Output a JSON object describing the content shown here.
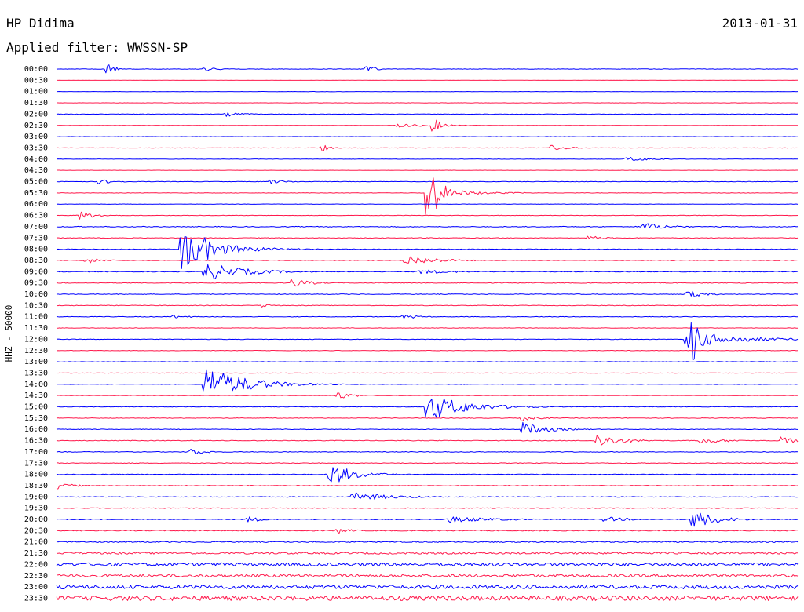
{
  "header": {
    "station": "HP Didima",
    "date": "2013-01-31",
    "filter_label": "Applied filter: WWSSN-SP"
  },
  "chart_data": {
    "type": "line",
    "chart_kind": "helicorder",
    "title": "HP Didima",
    "subtitle": "Applied filter: WWSSN-SP",
    "date": "2013-01-31",
    "ylabel": "HHZ - 50000",
    "xlabel": "",
    "grid": false,
    "legend": "none",
    "colors": [
      "#0000ff",
      "#ff1a4d"
    ],
    "row_ticks": [
      "00:00",
      "00:30",
      "01:00",
      "01:30",
      "02:00",
      "02:30",
      "03:00",
      "03:30",
      "04:00",
      "04:30",
      "05:00",
      "05:30",
      "06:00",
      "06:30",
      "07:00",
      "07:30",
      "08:00",
      "08:30",
      "09:00",
      "09:30",
      "10:00",
      "10:30",
      "11:00",
      "11:30",
      "12:00",
      "12:30",
      "13:00",
      "13:30",
      "14:00",
      "14:30",
      "15:00",
      "15:30",
      "16:00",
      "16:30",
      "17:00",
      "17:30",
      "18:00",
      "18:30",
      "19:00",
      "19:30",
      "20:00",
      "20:30",
      "21:00",
      "21:30",
      "22:00",
      "22:30",
      "23:00",
      "23:30"
    ],
    "row_noise": [
      0.05,
      0.01,
      0.03,
      0.03,
      0.05,
      0.03,
      0.04,
      0.04,
      0.04,
      0.03,
      0.05,
      0.05,
      0.04,
      0.04,
      0.08,
      0.06,
      0.07,
      0.07,
      0.08,
      0.07,
      0.07,
      0.06,
      0.06,
      0.05,
      0.05,
      0.05,
      0.05,
      0.05,
      0.05,
      0.05,
      0.06,
      0.06,
      0.06,
      0.07,
      0.07,
      0.07,
      0.07,
      0.07,
      0.07,
      0.08,
      0.08,
      0.1,
      0.12,
      0.2,
      0.35,
      0.3,
      0.4,
      0.5
    ],
    "events": [
      {
        "row": 0,
        "x": 0.07,
        "amp": 1.2,
        "dur": 0.01
      },
      {
        "row": 0,
        "x": 0.2,
        "amp": 0.5,
        "dur": 0.02
      },
      {
        "row": 0,
        "x": 0.42,
        "amp": 0.8,
        "dur": 0.01
      },
      {
        "row": 4,
        "x": 0.23,
        "amp": 0.5,
        "dur": 0.02
      },
      {
        "row": 5,
        "x": 0.46,
        "amp": 0.4,
        "dur": 0.05
      },
      {
        "row": 5,
        "x": 0.51,
        "amp": 1.5,
        "dur": 0.01
      },
      {
        "row": 7,
        "x": 0.36,
        "amp": 0.7,
        "dur": 0.01
      },
      {
        "row": 7,
        "x": 0.67,
        "amp": 0.6,
        "dur": 0.02
      },
      {
        "row": 8,
        "x": 0.77,
        "amp": 0.5,
        "dur": 0.03
      },
      {
        "row": 10,
        "x": 0.06,
        "amp": 0.5,
        "dur": 0.02
      },
      {
        "row": 10,
        "x": 0.29,
        "amp": 0.5,
        "dur": 0.02
      },
      {
        "row": 11,
        "x": 0.5,
        "amp": 8.0,
        "dur": 0.015
      },
      {
        "row": 11,
        "x": 0.51,
        "amp": 1.0,
        "dur": 0.05
      },
      {
        "row": 13,
        "x": 0.03,
        "amp": 1.0,
        "dur": 0.02
      },
      {
        "row": 14,
        "x": 0.79,
        "amp": 1.0,
        "dur": 0.03
      },
      {
        "row": 15,
        "x": 0.72,
        "amp": 0.5,
        "dur": 0.02
      },
      {
        "row": 16,
        "x": 0.17,
        "amp": 4.5,
        "dur": 0.04
      },
      {
        "row": 16,
        "x": 0.2,
        "amp": 2.5,
        "dur": 0.03
      },
      {
        "row": 16,
        "x": 0.23,
        "amp": 1.0,
        "dur": 0.05
      },
      {
        "row": 17,
        "x": 0.04,
        "amp": 0.7,
        "dur": 0.02
      },
      {
        "row": 17,
        "x": 0.47,
        "amp": 1.2,
        "dur": 0.04
      },
      {
        "row": 18,
        "x": 0.2,
        "amp": 2.0,
        "dur": 0.05
      },
      {
        "row": 18,
        "x": 0.49,
        "amp": 0.5,
        "dur": 0.05
      },
      {
        "row": 19,
        "x": 0.32,
        "amp": 1.0,
        "dur": 0.02
      },
      {
        "row": 20,
        "x": 0.85,
        "amp": 1.0,
        "dur": 0.02
      },
      {
        "row": 21,
        "x": 0.28,
        "amp": 0.5,
        "dur": 0.01
      },
      {
        "row": 22,
        "x": 0.16,
        "amp": 0.4,
        "dur": 0.02
      },
      {
        "row": 22,
        "x": 0.47,
        "amp": 0.5,
        "dur": 0.02
      },
      {
        "row": 24,
        "x": 0.85,
        "amp": 2.0,
        "dur": 0.06
      },
      {
        "row": 24,
        "x": 0.86,
        "amp": 5.0,
        "dur": 0.01
      },
      {
        "row": 28,
        "x": 0.2,
        "amp": 4.0,
        "dur": 0.05
      },
      {
        "row": 29,
        "x": 0.38,
        "amp": 0.8,
        "dur": 0.02
      },
      {
        "row": 30,
        "x": 0.5,
        "amp": 3.0,
        "dur": 0.05
      },
      {
        "row": 31,
        "x": 0.63,
        "amp": 0.6,
        "dur": 0.02
      },
      {
        "row": 32,
        "x": 0.63,
        "amp": 1.5,
        "dur": 0.03
      },
      {
        "row": 33,
        "x": 0.73,
        "amp": 1.5,
        "dur": 0.03
      },
      {
        "row": 33,
        "x": 0.87,
        "amp": 0.8,
        "dur": 0.03
      },
      {
        "row": 33,
        "x": 0.98,
        "amp": 0.8,
        "dur": 0.02
      },
      {
        "row": 34,
        "x": 0.18,
        "amp": 0.8,
        "dur": 0.02
      },
      {
        "row": 36,
        "x": 0.37,
        "amp": 2.5,
        "dur": 0.03
      },
      {
        "row": 37,
        "x": 0.0,
        "amp": 0.8,
        "dur": 0.02
      },
      {
        "row": 38,
        "x": 0.4,
        "amp": 1.0,
        "dur": 0.05
      },
      {
        "row": 40,
        "x": 0.26,
        "amp": 0.6,
        "dur": 0.02
      },
      {
        "row": 40,
        "x": 0.53,
        "amp": 0.7,
        "dur": 0.06
      },
      {
        "row": 40,
        "x": 0.74,
        "amp": 0.6,
        "dur": 0.03
      },
      {
        "row": 40,
        "x": 0.86,
        "amp": 2.0,
        "dur": 0.03
      },
      {
        "row": 41,
        "x": 0.38,
        "amp": 0.6,
        "dur": 0.02
      }
    ]
  }
}
